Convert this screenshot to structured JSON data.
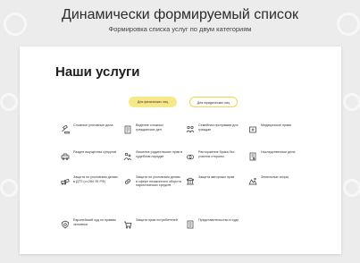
{
  "heading": "Динамически формируемый список",
  "subheading": "Формировка списка услуг по двум категориям",
  "card": {
    "title": "Наши услуги",
    "tabs": [
      {
        "label": "Для физических лиц",
        "active": true
      },
      {
        "label": "Для юридических лиц",
        "active": false
      }
    ]
  },
  "services": [
    {
      "label": "Сложные уголовные дела",
      "icon": "gavel-icon"
    },
    {
      "label": "Ведение сложных гражданских дел",
      "icon": "documents-icon"
    },
    {
      "label": "Семейная программа для граждан",
      "icon": "family-icon"
    },
    {
      "label": "Медицинское право",
      "icon": "medical-icon"
    },
    {
      "label": "Раздел имущества супругов",
      "icon": "car-icon"
    },
    {
      "label": "Лишение родительских прав в судебном порядке",
      "icon": "parents-icon"
    },
    {
      "label": "Расторжение брака без участия стороны",
      "icon": "rings-icon"
    },
    {
      "label": "Наследственные дела",
      "icon": "inheritance-icon"
    },
    {
      "label": "Защита по уголовным делам в ДТП (ст.264 УК РФ)",
      "icon": "accident-icon"
    },
    {
      "label": "Защита по уголовным делам в сфере незаконного оборота наркотических средств",
      "icon": "drugs-icon"
    },
    {
      "label": "Защита авторских прав",
      "icon": "copyright-icon"
    },
    {
      "label": "Земельные споры",
      "icon": "land-icon"
    },
    {
      "label": "Европейский суд по правам человека",
      "icon": "europe-icon"
    },
    {
      "label": "Защита прав потребителей",
      "icon": "consumer-icon"
    },
    {
      "label": "Представительство в суде",
      "icon": "court-icon"
    }
  ]
}
